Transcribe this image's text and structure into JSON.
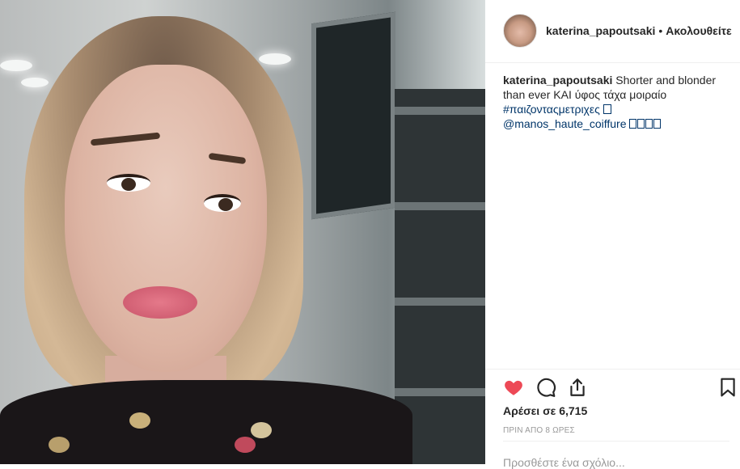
{
  "post": {
    "username": "katerina_papoutsaki",
    "separator": "•",
    "follow_label": "Ακολουθείτε",
    "caption_user": "katerina_papoutsaki",
    "caption_text": "Shorter and blonder than ever ΚΑΙ ύφος τάχα μοιραίο",
    "hashtag": "#παιζονταςμετριχες",
    "mention": "@manos_haute_coiffure"
  },
  "actions": {
    "like_icon": "heart-filled-icon",
    "comment_icon": "comment-icon",
    "share_icon": "share-icon",
    "save_icon": "bookmark-icon",
    "like_color": "#ed4956"
  },
  "stats": {
    "likes": "Αρέσει σε 6,715",
    "timestamp": "ΠΡΙΝ ΑΠΟ 8 ΩΡΕΣ"
  },
  "comment": {
    "placeholder": "Προσθέστε ένα σχόλιο..."
  }
}
